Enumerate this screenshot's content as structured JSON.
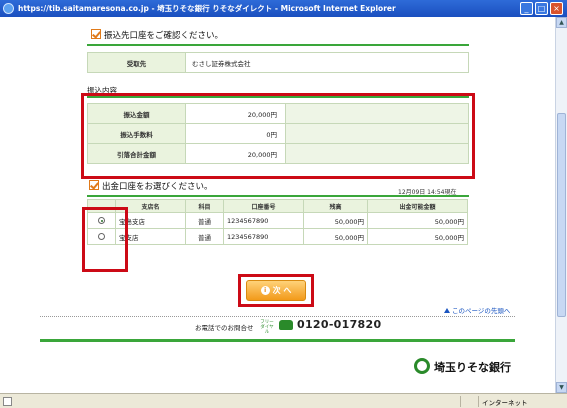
{
  "window": {
    "title": "https://tib.saitamaresona.co.jp - 埼玉りそな銀行 りそなダイレクト - Microsoft Internet Explorer"
  },
  "recipient_section": {
    "heading": "振込先口座をご確認ください。",
    "label": "受取先",
    "value": "むさし証券株式会社"
  },
  "transfer_section": {
    "heading": "振込内容",
    "rows": [
      {
        "label": "振込金額",
        "value": "20,000円"
      },
      {
        "label": "振込手数料",
        "value": "0円"
      },
      {
        "label": "引落合計金額",
        "value": "20,000円"
      }
    ]
  },
  "account_section": {
    "heading": "出金口座をお選びください。",
    "timestamp": "12月09日 14:54現在",
    "columns": [
      "支店名",
      "科目",
      "口座番号",
      "残高",
      "出金可能金額"
    ],
    "rows": [
      {
        "selected": true,
        "branch": "宝島支店",
        "type": "普通",
        "number": "1234567890",
        "balance": "50,000円",
        "available": "50,000円"
      },
      {
        "selected": false,
        "branch": "宝支店",
        "type": "普通",
        "number": "1234567890",
        "balance": "50,000円",
        "available": "50,000円"
      }
    ]
  },
  "next_button": {
    "label": "次 へ",
    "icon": "circle-i"
  },
  "page_top_link": "このページの先頭へ",
  "footer": {
    "contact_label": "お電話でのお問合せ",
    "freedial": "フリーダイヤル",
    "phone": "0120-017820",
    "bank_name": "埼玉りそな銀行"
  },
  "statusbar": {
    "zone": "インターネット"
  },
  "colors": {
    "accent_green": "#3aa63a",
    "highlight_red": "#cc0a16",
    "button_orange": "#f29a1a"
  }
}
